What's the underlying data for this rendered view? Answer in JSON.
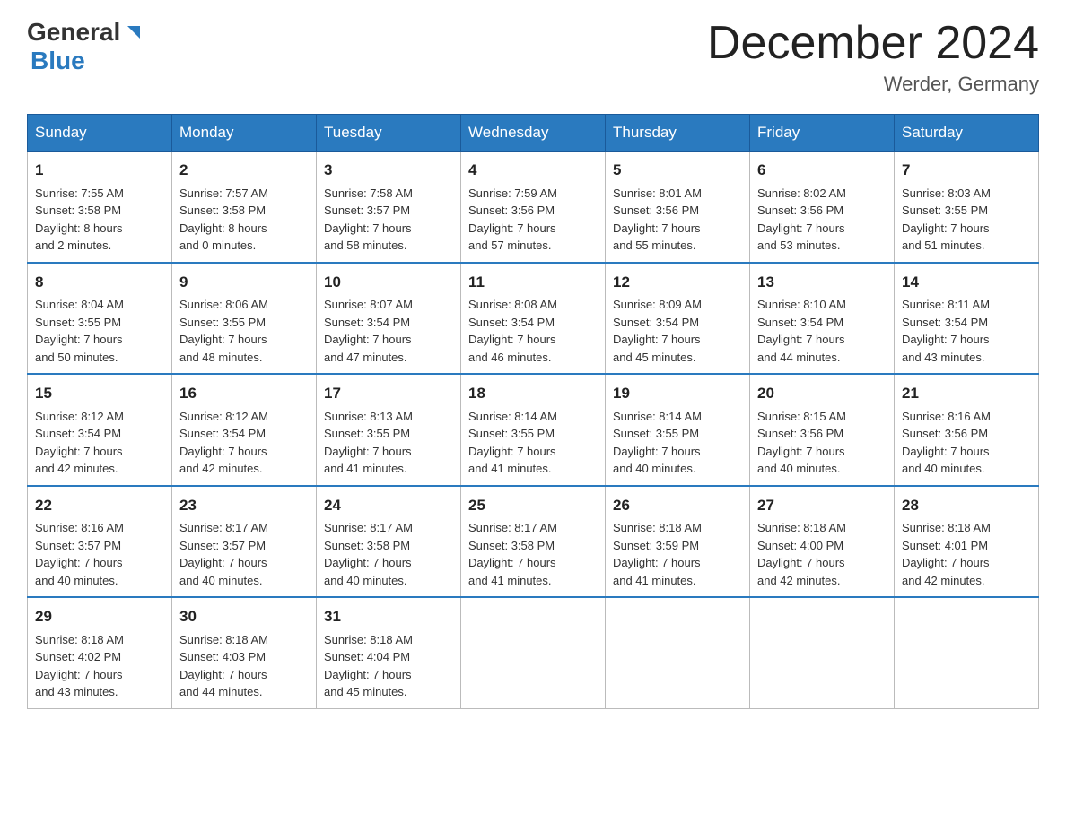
{
  "logo": {
    "text_general": "General",
    "text_blue": "Blue"
  },
  "title": {
    "month_year": "December 2024",
    "location": "Werder, Germany"
  },
  "days_of_week": [
    "Sunday",
    "Monday",
    "Tuesday",
    "Wednesday",
    "Thursday",
    "Friday",
    "Saturday"
  ],
  "weeks": [
    [
      {
        "day": "1",
        "sunrise": "7:55 AM",
        "sunset": "3:58 PM",
        "daylight": "8 hours and 2 minutes."
      },
      {
        "day": "2",
        "sunrise": "7:57 AM",
        "sunset": "3:58 PM",
        "daylight": "8 hours and 0 minutes."
      },
      {
        "day": "3",
        "sunrise": "7:58 AM",
        "sunset": "3:57 PM",
        "daylight": "7 hours and 58 minutes."
      },
      {
        "day": "4",
        "sunrise": "7:59 AM",
        "sunset": "3:56 PM",
        "daylight": "7 hours and 57 minutes."
      },
      {
        "day": "5",
        "sunrise": "8:01 AM",
        "sunset": "3:56 PM",
        "daylight": "7 hours and 55 minutes."
      },
      {
        "day": "6",
        "sunrise": "8:02 AM",
        "sunset": "3:56 PM",
        "daylight": "7 hours and 53 minutes."
      },
      {
        "day": "7",
        "sunrise": "8:03 AM",
        "sunset": "3:55 PM",
        "daylight": "7 hours and 51 minutes."
      }
    ],
    [
      {
        "day": "8",
        "sunrise": "8:04 AM",
        "sunset": "3:55 PM",
        "daylight": "7 hours and 50 minutes."
      },
      {
        "day": "9",
        "sunrise": "8:06 AM",
        "sunset": "3:55 PM",
        "daylight": "7 hours and 48 minutes."
      },
      {
        "day": "10",
        "sunrise": "8:07 AM",
        "sunset": "3:54 PM",
        "daylight": "7 hours and 47 minutes."
      },
      {
        "day": "11",
        "sunrise": "8:08 AM",
        "sunset": "3:54 PM",
        "daylight": "7 hours and 46 minutes."
      },
      {
        "day": "12",
        "sunrise": "8:09 AM",
        "sunset": "3:54 PM",
        "daylight": "7 hours and 45 minutes."
      },
      {
        "day": "13",
        "sunrise": "8:10 AM",
        "sunset": "3:54 PM",
        "daylight": "7 hours and 44 minutes."
      },
      {
        "day": "14",
        "sunrise": "8:11 AM",
        "sunset": "3:54 PM",
        "daylight": "7 hours and 43 minutes."
      }
    ],
    [
      {
        "day": "15",
        "sunrise": "8:12 AM",
        "sunset": "3:54 PM",
        "daylight": "7 hours and 42 minutes."
      },
      {
        "day": "16",
        "sunrise": "8:12 AM",
        "sunset": "3:54 PM",
        "daylight": "7 hours and 42 minutes."
      },
      {
        "day": "17",
        "sunrise": "8:13 AM",
        "sunset": "3:55 PM",
        "daylight": "7 hours and 41 minutes."
      },
      {
        "day": "18",
        "sunrise": "8:14 AM",
        "sunset": "3:55 PM",
        "daylight": "7 hours and 41 minutes."
      },
      {
        "day": "19",
        "sunrise": "8:14 AM",
        "sunset": "3:55 PM",
        "daylight": "7 hours and 40 minutes."
      },
      {
        "day": "20",
        "sunrise": "8:15 AM",
        "sunset": "3:56 PM",
        "daylight": "7 hours and 40 minutes."
      },
      {
        "day": "21",
        "sunrise": "8:16 AM",
        "sunset": "3:56 PM",
        "daylight": "7 hours and 40 minutes."
      }
    ],
    [
      {
        "day": "22",
        "sunrise": "8:16 AM",
        "sunset": "3:57 PM",
        "daylight": "7 hours and 40 minutes."
      },
      {
        "day": "23",
        "sunrise": "8:17 AM",
        "sunset": "3:57 PM",
        "daylight": "7 hours and 40 minutes."
      },
      {
        "day": "24",
        "sunrise": "8:17 AM",
        "sunset": "3:58 PM",
        "daylight": "7 hours and 40 minutes."
      },
      {
        "day": "25",
        "sunrise": "8:17 AM",
        "sunset": "3:58 PM",
        "daylight": "7 hours and 41 minutes."
      },
      {
        "day": "26",
        "sunrise": "8:18 AM",
        "sunset": "3:59 PM",
        "daylight": "7 hours and 41 minutes."
      },
      {
        "day": "27",
        "sunrise": "8:18 AM",
        "sunset": "4:00 PM",
        "daylight": "7 hours and 42 minutes."
      },
      {
        "day": "28",
        "sunrise": "8:18 AM",
        "sunset": "4:01 PM",
        "daylight": "7 hours and 42 minutes."
      }
    ],
    [
      {
        "day": "29",
        "sunrise": "8:18 AM",
        "sunset": "4:02 PM",
        "daylight": "7 hours and 43 minutes."
      },
      {
        "day": "30",
        "sunrise": "8:18 AM",
        "sunset": "4:03 PM",
        "daylight": "7 hours and 44 minutes."
      },
      {
        "day": "31",
        "sunrise": "8:18 AM",
        "sunset": "4:04 PM",
        "daylight": "7 hours and 45 minutes."
      },
      null,
      null,
      null,
      null
    ]
  ],
  "labels": {
    "sunrise": "Sunrise: ",
    "sunset": "Sunset: ",
    "daylight": "Daylight: "
  }
}
